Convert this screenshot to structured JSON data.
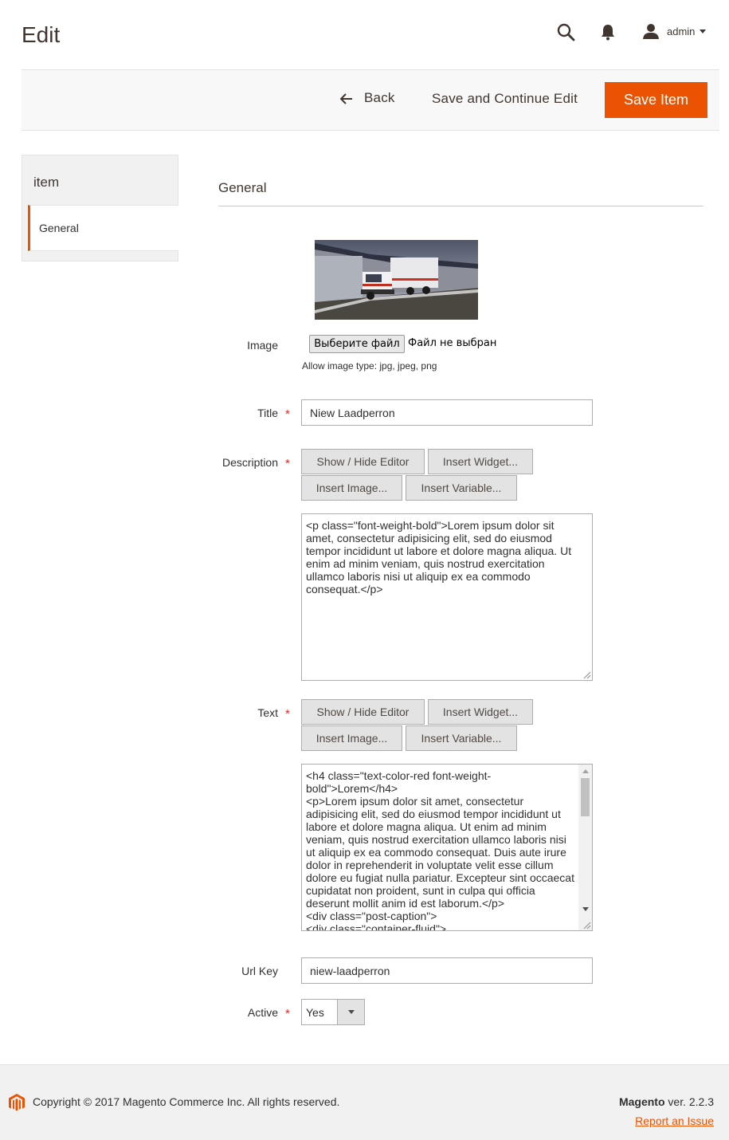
{
  "header": {
    "page_title": "Edit",
    "user_name": "admin"
  },
  "actions": {
    "back_label": "Back",
    "save_continue_label": "Save and Continue Edit",
    "save_item_label": "Save Item"
  },
  "sidebar": {
    "title": "item",
    "items": [
      {
        "label": "General"
      }
    ]
  },
  "section": {
    "title": "General"
  },
  "form": {
    "image": {
      "label": "Image",
      "choose_button": "Выберите файл",
      "file_status": "Файл не выбран",
      "note": "Allow image type: jpg, jpeg, png"
    },
    "title": {
      "label": "Title",
      "value": "Niew Laadperron"
    },
    "description": {
      "label": "Description",
      "buttons": [
        "Show / Hide Editor",
        "Insert Widget...",
        "Insert Image...",
        "Insert Variable..."
      ],
      "value": "<p class=\"font-weight-bold\">Lorem ipsum dolor sit amet, consectetur adipisicing elit, sed do eiusmod tempor incididunt ut labore et dolore magna aliqua. Ut enim ad minim veniam, quis nostrud exercitation ullamco laboris nisi ut aliquip ex ea commodo consequat.</p>"
    },
    "text": {
      "label": "Text",
      "buttons": [
        "Show / Hide Editor",
        "Insert Widget...",
        "Insert Image...",
        "Insert Variable..."
      ],
      "value": "<h4 class=\"text-color-red font-weight-bold\">Lorem</h4>\n<p>Lorem ipsum dolor sit amet, consectetur adipisicing elit, sed do eiusmod tempor incididunt ut labore et dolore magna aliqua. Ut enim ad minim veniam, quis nostrud exercitation ullamco laboris nisi ut aliquip ex ea commodo consequat. Duis aute irure dolor in reprehenderit in voluptate velit esse cillum dolore eu fugiat nulla pariatur. Excepteur sint occaecat cupidatat non proident, sunt in culpa qui officia deserunt mollit anim id est laborum.</p>\n<div class=\"post-caption\">\n<div class=\"container-fluid\">"
    },
    "url_key": {
      "label": "Url Key",
      "value": "niew-laadperron"
    },
    "active": {
      "label": "Active",
      "value": "Yes"
    },
    "required_mark": "*"
  },
  "footer": {
    "copyright": "Copyright © 2017 Magento Commerce Inc. All rights reserved.",
    "brand": "Magento",
    "version": "ver. 2.2.3",
    "report_link": "Report an Issue"
  },
  "colors": {
    "accent": "#eb5202",
    "required": "#e22626",
    "text": "#303030"
  },
  "icons": [
    "search-icon",
    "bell-icon",
    "user-icon",
    "arrow-left-icon",
    "magento-logo-icon",
    "chevron-down-icon"
  ]
}
